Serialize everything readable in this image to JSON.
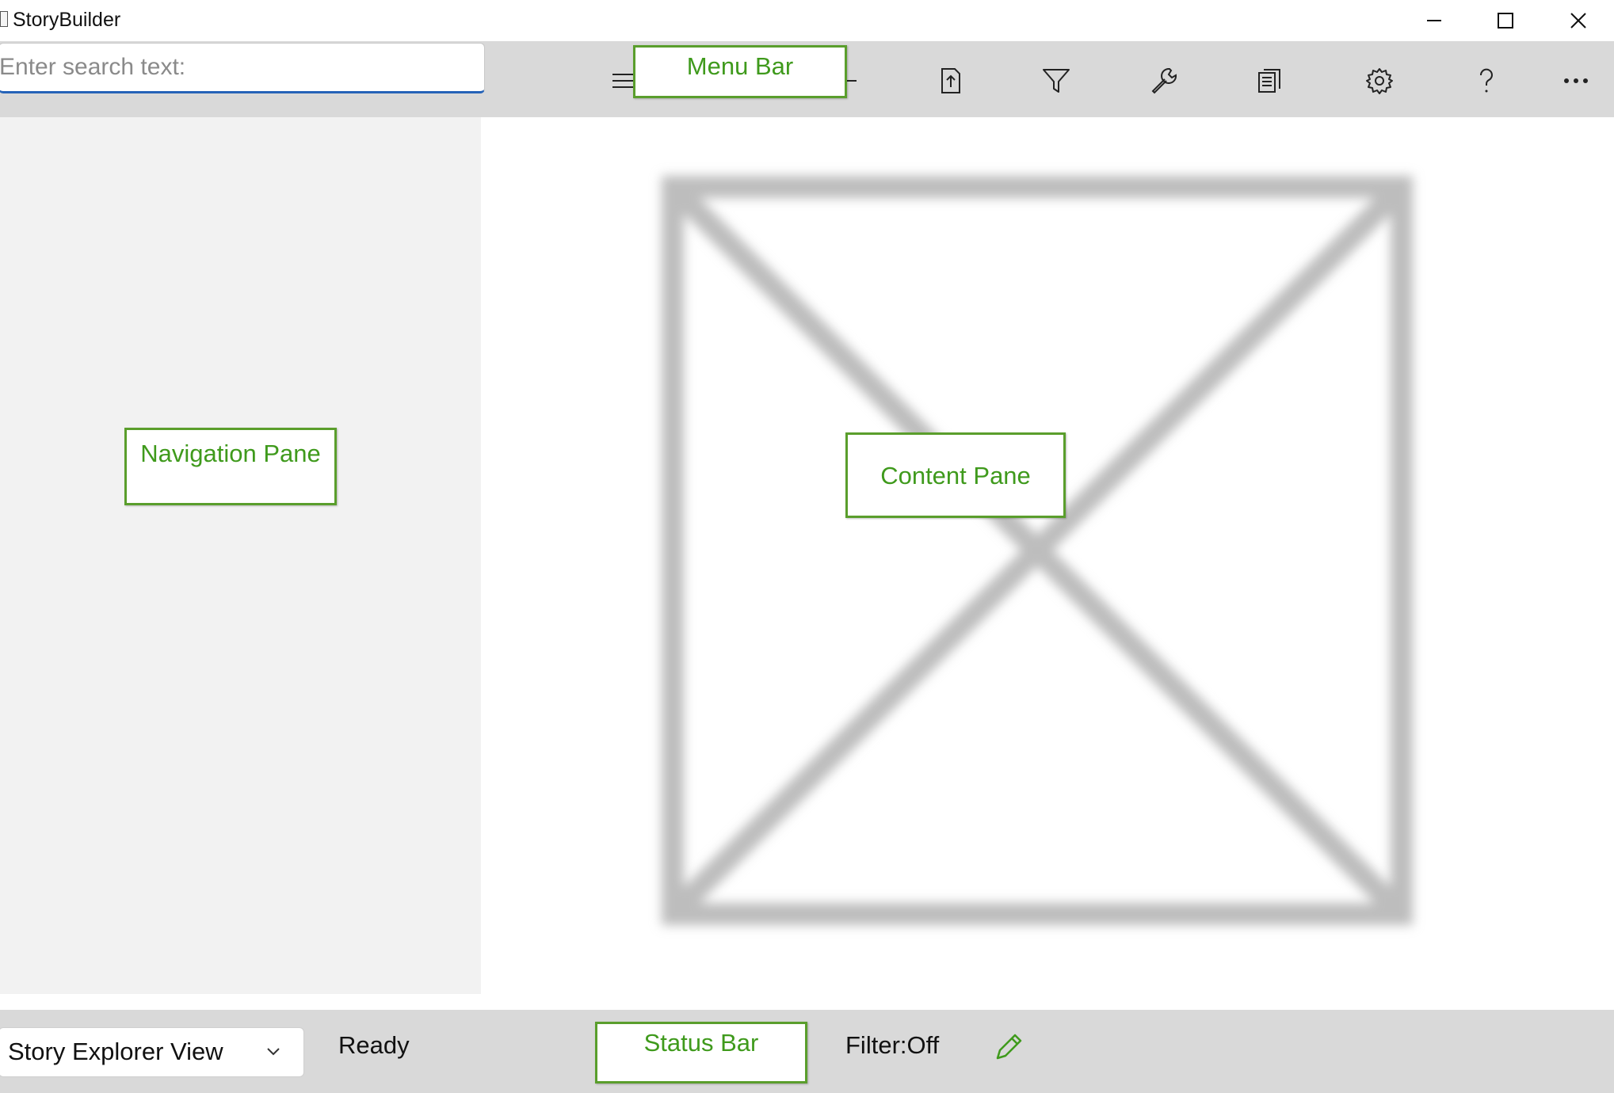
{
  "window": {
    "title": "StoryBuilder",
    "controls": {
      "minimize": "minimize-icon",
      "maximize": "maximize-icon",
      "close": "close-icon"
    }
  },
  "menubar": {
    "search_placeholder": "Enter search text:",
    "search_value": "",
    "tools": [
      "menu-icon",
      "add-icon",
      "move-icon",
      "filter-icon",
      "tools-icon",
      "reports-icon",
      "settings-icon",
      "help-icon",
      "more-icon"
    ]
  },
  "status": {
    "view_selector": "Story Explorer View",
    "ready": "Ready",
    "filter": "Filter:Off",
    "edit_icon": "pencil-icon"
  },
  "callouts": {
    "menu_bar": "Menu Bar",
    "navigation_pane": "Navigation Pane",
    "content_pane": "Content Pane",
    "status_bar": "Status Bar"
  },
  "colors": {
    "accent_blue": "#2563b8",
    "callout_green": "#5a9e2c",
    "bar_gray": "#d9d9d9",
    "nav_gray": "#f2f2f2"
  }
}
